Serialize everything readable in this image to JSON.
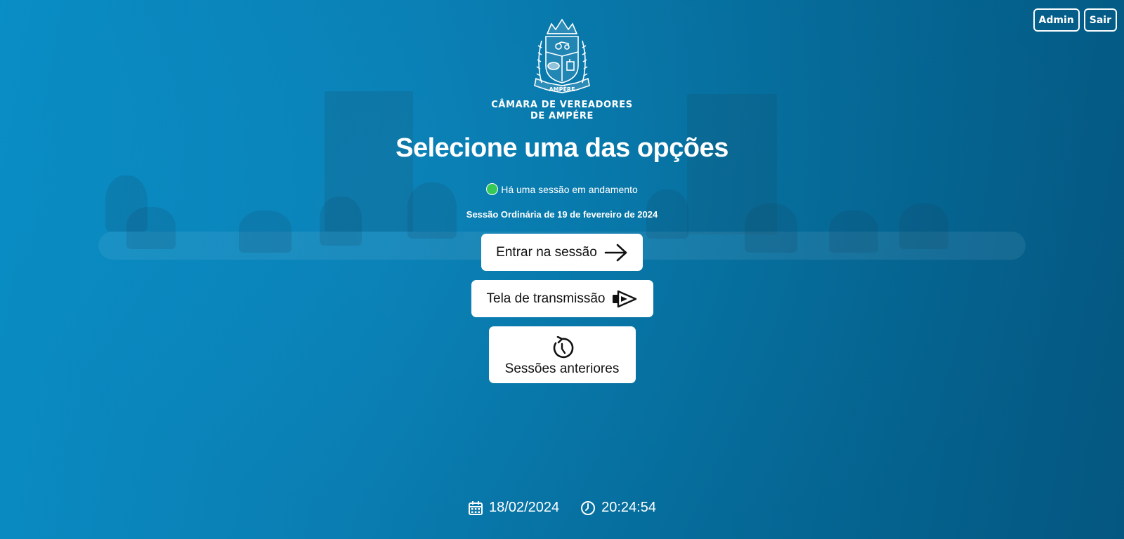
{
  "header": {
    "admin_label": "Admin",
    "logout_label": "Sair"
  },
  "crest": {
    "banner_text": "AMPÈRE"
  },
  "organization": {
    "line1": "CÂMARA DE VEREADORES",
    "line2": "DE AMPÉRE"
  },
  "main": {
    "title": "Selecione uma das opções",
    "status_text": "Há uma sessão em andamento",
    "status_color": "#35c957",
    "session_name": "Sessão Ordinária de 19 de fevereiro de 2024",
    "enter_label": "Entrar na sessão",
    "broadcast_label": "Tela de transmissão",
    "previous_label": "Sessões anteriores"
  },
  "footer": {
    "date": "18/02/2024",
    "time": "20:24:54"
  },
  "icons": {
    "enter": "arrow-right-icon",
    "broadcast": "camera-play-icon",
    "previous": "history-icon",
    "date": "calendar-icon",
    "time": "clock-icon"
  },
  "colors": {
    "bg_start": "#0a97d0",
    "bg_end": "#045a83",
    "button_bg": "#ffffff",
    "button_text": "#111111"
  }
}
